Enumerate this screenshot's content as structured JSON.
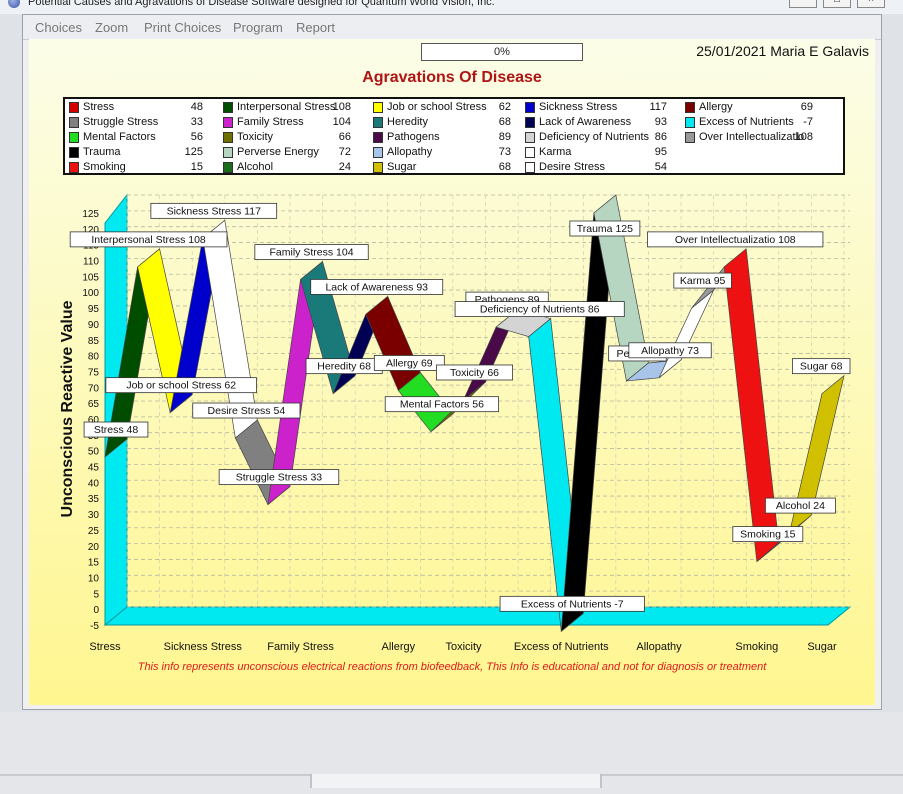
{
  "window": {
    "title": "Potential Causes and Agravations of Disease   Software designed for Quantum World Vision, Inc."
  },
  "menu": [
    {
      "label": "Choices"
    },
    {
      "label": "Zoom"
    },
    {
      "label": "Print Choices"
    },
    {
      "label": "Program"
    },
    {
      "label": "Report"
    }
  ],
  "header": {
    "progress": "0%",
    "date_user": "25/01/2021 Maria E Galavis"
  },
  "chart_data": {
    "type": "line",
    "title": "Agravations Of Disease",
    "ylabel": "Unconscious Reactive Value",
    "xlabel": "",
    "ylim": [
      -5,
      125
    ],
    "ytick_step": 5,
    "grid": true,
    "legend_position": "top",
    "categories": [
      "Stress",
      "Struggle Stress",
      "Mental Factors",
      "Trauma",
      "Smoking",
      "Interpersonal Stress",
      "Family Stress",
      "Toxicity",
      "Perverse Energy",
      "Alcohol",
      "Job or school Stress",
      "Heredity",
      "Pathogens",
      "Allopathy",
      "Sugar",
      "Sickness Stress",
      "Lack of Awareness",
      "Deficiency of Nutrients",
      "Karma",
      "Desire Stress",
      "Allergy",
      "Excess of Nutrients",
      "Over Intellectualizatio"
    ],
    "colors": [
      "#d40000",
      "#808080",
      "#22dd22",
      "#000000",
      "#ee1111",
      "#004d00",
      "#cc22cc",
      "#6f6f00",
      "#b6d6c2",
      "#1a6b1a",
      "#ffff00",
      "#1a7a7a",
      "#4a0a4a",
      "#a8c4e8",
      "#d0c000",
      "#0000cc",
      "#000055",
      "#d4d4d4",
      "#ffffff",
      "#ffffff",
      "#7a0000",
      "#00e8f0",
      "#999999"
    ],
    "values": [
      48,
      33,
      56,
      125,
      15,
      108,
      104,
      66,
      72,
      24,
      62,
      68,
      89,
      73,
      68,
      117,
      93,
      86,
      95,
      54,
      69,
      -7,
      108
    ],
    "plot_order": [
      "Stress",
      "Interpersonal Stress",
      "Job or school Stress",
      "Sickness Stress",
      "Desire Stress",
      "Struggle Stress",
      "Family Stress",
      "Heredity",
      "Lack of Awareness",
      "Allergy",
      "Mental Factors",
      "Toxicity",
      "Pathogens",
      "Deficiency of Nutrients",
      "Excess of Nutrients",
      "Trauma",
      "Perverse Energy",
      "Allopathy",
      "Karma",
      "Over Intellectualizatio",
      "Smoking",
      "Alcohol",
      "Sugar"
    ],
    "x_tick_labels": [
      "Stress",
      "Sickness Stress",
      "Family Stress",
      "Allergy",
      "Toxicity",
      "Excess of Nutrients",
      "Allopathy",
      "Smoking",
      "Sugar"
    ],
    "point_labels": [
      "Stress 48",
      "Interpersonal Stress 108",
      "Job or school Stress 62",
      "Sickness Stress 117",
      "Desire Stress 54",
      "Struggle Stress 33",
      "Family Stress 104",
      "Heredity 68",
      "Lack of Awareness 93",
      "Allergy 69",
      "Mental Factors 56",
      "Toxicity 66",
      "Pathogens 89",
      "Deficiency of Nutrients 86",
      "Excess of Nutrients -7",
      "Trauma 125",
      "Perverse",
      "Allopathy 73",
      "Karma 95",
      "Over Intellectualizatio 108",
      "Smoking 15",
      "Alcohol 24",
      "Sugar 68"
    ]
  },
  "note": "This info represents unconscious electrical reactions from biofeedback, This Info is educational and  not  for diagnosis or treatment"
}
